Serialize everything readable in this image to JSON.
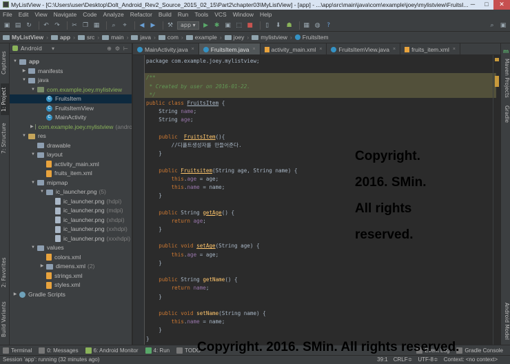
{
  "window": {
    "title": "MyListView - [C:\\Users\\user\\Desktop\\Dolt_Android_Rev2_Source_2015_02_15\\Part2\\chapter03\\MyListView] - [app] - ...\\app\\src\\main\\java\\com\\example\\joey\\mylistview\\FruitsI...",
    "min": "─",
    "max": "□",
    "close": "✕"
  },
  "menu": [
    "File",
    "Edit",
    "View",
    "Navigate",
    "Code",
    "Analyze",
    "Refactor",
    "Build",
    "Run",
    "Tools",
    "VCS",
    "Window",
    "Help"
  ],
  "toolbar": {
    "run_config": "app ▾",
    "search": "⌕"
  },
  "breadcrumb": [
    "MyListView",
    "app",
    "src",
    "main",
    "java",
    "com",
    "example",
    "joey",
    "mylistview",
    "FruitsItem"
  ],
  "project_panel": {
    "view": "Android",
    "controls": [
      "⊕",
      "⚙",
      "⊢"
    ],
    "tree": [
      {
        "label": "app",
        "indent": 0,
        "arrow": "▼",
        "icon": "folder",
        "bold": true
      },
      {
        "label": "manifests",
        "indent": 1,
        "arrow": "▶",
        "icon": "folder"
      },
      {
        "label": "java",
        "indent": 1,
        "arrow": "▼",
        "icon": "folder"
      },
      {
        "label": "com.example.joey.mylistview",
        "indent": 2,
        "arrow": "▼",
        "icon": "pkg"
      },
      {
        "label": "FruitsItem",
        "indent": 3,
        "arrow": "",
        "icon": "class",
        "selected": true
      },
      {
        "label": "FruitsItemView",
        "indent": 3,
        "arrow": "",
        "icon": "class"
      },
      {
        "label": "MainActivity",
        "indent": 3,
        "arrow": "",
        "icon": "class"
      },
      {
        "label": "com.example.joey.mylistview",
        "suffix": "(andro",
        "indent": 2,
        "arrow": "▶",
        "icon": "pkg"
      },
      {
        "label": "res",
        "indent": 1,
        "arrow": "▼",
        "icon": "res"
      },
      {
        "label": "drawable",
        "indent": 2,
        "arrow": "",
        "icon": "folder"
      },
      {
        "label": "layout",
        "indent": 2,
        "arrow": "▼",
        "icon": "folder"
      },
      {
        "label": "activity_main.xml",
        "indent": 3,
        "arrow": "",
        "icon": "xml"
      },
      {
        "label": "fruits_item.xml",
        "indent": 3,
        "arrow": "",
        "icon": "xml"
      },
      {
        "label": "mipmap",
        "indent": 2,
        "arrow": "▼",
        "icon": "folder"
      },
      {
        "label": "ic_launcher.png",
        "suffix": "(5)",
        "indent": 3,
        "arrow": "▼",
        "icon": "folder"
      },
      {
        "label": "ic_launcher.png",
        "suffix": "(hdpi)",
        "indent": 4,
        "arrow": "",
        "icon": "png"
      },
      {
        "label": "ic_launcher.png",
        "suffix": "(mdpi)",
        "indent": 4,
        "arrow": "",
        "icon": "png"
      },
      {
        "label": "ic_launcher.png",
        "suffix": "(xhdpi)",
        "indent": 4,
        "arrow": "",
        "icon": "png"
      },
      {
        "label": "ic_launcher.png",
        "suffix": "(xxhdpi)",
        "indent": 4,
        "arrow": "",
        "icon": "png"
      },
      {
        "label": "ic_launcher.png",
        "suffix": "(xxxhdpi)",
        "indent": 4,
        "arrow": "",
        "icon": "png"
      },
      {
        "label": "values",
        "indent": 2,
        "arrow": "▼",
        "icon": "folder"
      },
      {
        "label": "colors.xml",
        "indent": 3,
        "arrow": "",
        "icon": "xml"
      },
      {
        "label": "dimens.xml",
        "suffix": "(2)",
        "indent": 3,
        "arrow": "▶",
        "icon": "folder"
      },
      {
        "label": "strings.xml",
        "indent": 3,
        "arrow": "",
        "icon": "xml"
      },
      {
        "label": "styles.xml",
        "indent": 3,
        "arrow": "",
        "icon": "xml"
      },
      {
        "label": "Gradle Scripts",
        "indent": 0,
        "arrow": "▶",
        "icon": "gradle"
      }
    ]
  },
  "left_tools": [
    "1: Project",
    "Captures",
    "7: Structure",
    "2: Favorites",
    "Build Variants"
  ],
  "right_tools": [
    "Maven Projects",
    "Gradle",
    "Android Model"
  ],
  "tabs": [
    {
      "label": "MainActivity.java",
      "type": "class"
    },
    {
      "label": "FruitsItem.java",
      "type": "class",
      "active": true
    },
    {
      "label": "activity_main.xml",
      "type": "xml"
    },
    {
      "label": "FruitsItemView.java",
      "type": "class"
    },
    {
      "label": "fruits_item.xml",
      "type": "xml"
    }
  ],
  "code": [
    [
      [
        "p",
        "package com.example.joey.mylistview;"
      ]
    ],
    [],
    [
      [
        "c",
        "/**"
      ]
    ],
    [
      [
        "c",
        " * Created by user on 2016-01-22."
      ]
    ],
    [
      [
        "c",
        " */"
      ]
    ],
    [
      [
        "k",
        "public class "
      ],
      [
        "u",
        "FruitsItem"
      ],
      [
        "p",
        " {"
      ]
    ],
    [
      [
        "p",
        "    String "
      ],
      [
        "f",
        "name"
      ],
      [
        "p",
        ";"
      ]
    ],
    [
      [
        "p",
        "    String "
      ],
      [
        "f",
        "age"
      ],
      [
        "p",
        ";"
      ]
    ],
    [],
    [
      [
        "k",
        "    public  "
      ],
      [
        "mu",
        "FruitsItem"
      ],
      [
        "p",
        "(){"
      ]
    ],
    [
      [
        "p",
        "        //디폴트생성자를 만들어준다."
      ]
    ],
    [
      [
        "p",
        "    }"
      ]
    ],
    [],
    [
      [
        "k",
        "    public "
      ],
      [
        "mu",
        "Fruitsitem"
      ],
      [
        "p",
        "(String age, String name) {"
      ]
    ],
    [
      [
        "k",
        "        this"
      ],
      [
        "p",
        "."
      ],
      [
        "f",
        "age"
      ],
      [
        "p",
        " = age;"
      ]
    ],
    [
      [
        "k",
        "        this"
      ],
      [
        "p",
        "."
      ],
      [
        "f",
        "name"
      ],
      [
        "p",
        " = name;"
      ]
    ],
    [
      [
        "p",
        "    }"
      ]
    ],
    [],
    [
      [
        "k",
        "    public "
      ],
      [
        "p",
        "String "
      ],
      [
        "mu",
        "getAge"
      ],
      [
        "p",
        "() {"
      ]
    ],
    [
      [
        "k",
        "        return "
      ],
      [
        "f",
        "age"
      ],
      [
        "p",
        ";"
      ]
    ],
    [
      [
        "p",
        "    }"
      ]
    ],
    [],
    [
      [
        "k",
        "    public void "
      ],
      [
        "mu",
        "setAge"
      ],
      [
        "p",
        "(String age) {"
      ]
    ],
    [
      [
        "k",
        "        this"
      ],
      [
        "p",
        "."
      ],
      [
        "f",
        "age"
      ],
      [
        "p",
        " = age;"
      ]
    ],
    [
      [
        "p",
        "    }"
      ]
    ],
    [],
    [
      [
        "k",
        "    public "
      ],
      [
        "p",
        "String "
      ],
      [
        "m",
        "getName"
      ],
      [
        "p",
        "() {"
      ]
    ],
    [
      [
        "k",
        "        return "
      ],
      [
        "f",
        "name"
      ],
      [
        "p",
        ";"
      ]
    ],
    [
      [
        "p",
        "    }"
      ]
    ],
    [],
    [
      [
        "k",
        "    public void "
      ],
      [
        "m",
        "setName"
      ],
      [
        "p",
        "(String name) {"
      ]
    ],
    [
      [
        "k",
        "        this"
      ],
      [
        "p",
        "."
      ],
      [
        "f",
        "name"
      ],
      [
        "p",
        " = name;"
      ]
    ],
    [
      [
        "p",
        "    }"
      ]
    ],
    [
      [
        "p",
        "}"
      ]
    ]
  ],
  "watermark_mid": [
    "Copyright.",
    "2016. SMin.",
    "All rights",
    "reserved."
  ],
  "watermark_bottom": "Copyright. 2016. SMin. All rights reserved.",
  "bottom_tools": [
    "Terminal",
    "0: Messages",
    "6: Android Monitor",
    "4: Run",
    "TODO",
    "Event Log",
    "Gradle Console"
  ],
  "status": {
    "message": "Session 'app': running (32 minutes ago)",
    "position": "39:1",
    "line_sep": "CRLF≑",
    "encoding": "UTF-8≑",
    "context": "Context: <no context>"
  }
}
